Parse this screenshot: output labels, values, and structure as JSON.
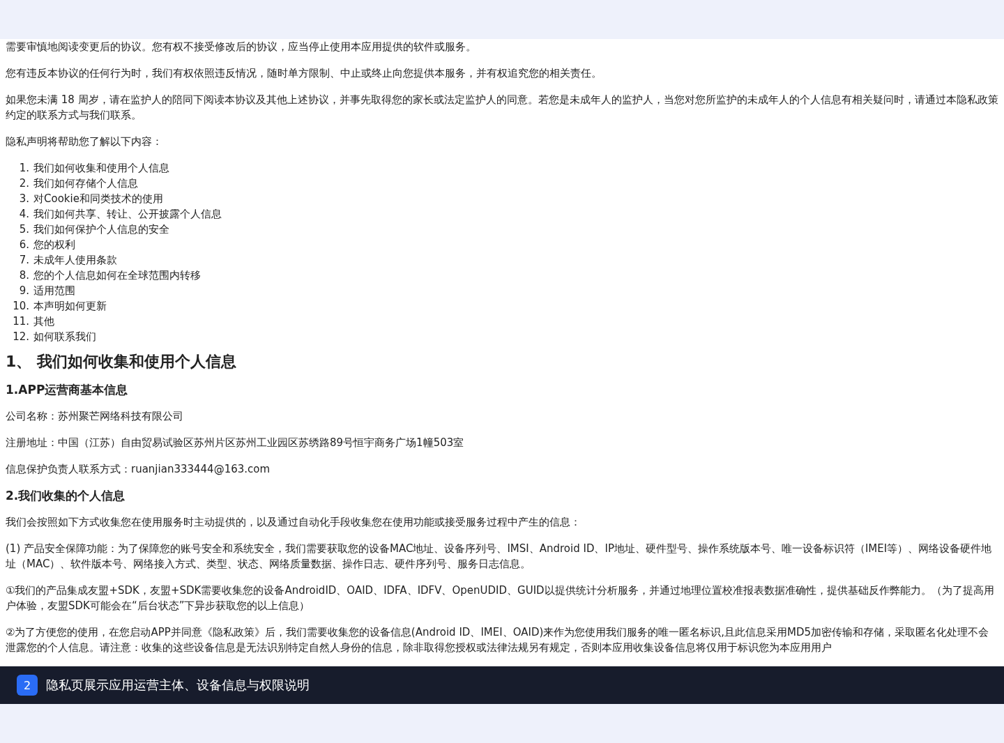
{
  "intro": [
    "需要审慎地阅读变更后的协议。您有权不接受修改后的协议，应当停止使用本应用提供的软件或服务。",
    "您有违反本协议的任何行为时，我们有权依照违反情况，随时单方限制、中止或终止向您提供本服务，并有权追究您的相关责任。",
    "如果您未满 18 周岁，请在监护人的陪同下阅读本协议及其他上述协议，并事先取得您的家长或法定监护人的同意。若您是未成年人的监护人，当您对您所监护的未成年人的个人信息有相关疑问时，请通过本隐私政策约定的联系方式与我们联系。",
    "隐私声明将帮助您了解以下内容："
  ],
  "toc": [
    {
      "number": "1.",
      "text": "我们如何收集和使用个人信息"
    },
    {
      "number": "2.",
      "text": "我们如何存储个人信息"
    },
    {
      "number": "3.",
      "text": "对Cookie和同类技术的使用"
    },
    {
      "number": "4.",
      "text": "我们如何共享、转让、公开披露个人信息"
    },
    {
      "number": "5.",
      "text": "我们如何保护个人信息的安全"
    },
    {
      "number": "6.",
      "text": "您的权利"
    },
    {
      "number": "7.",
      "text": "未成年人使用条款"
    },
    {
      "number": "8.",
      "text": "您的个人信息如何在全球范围内转移"
    },
    {
      "number": "9.",
      "text": "适用范围"
    },
    {
      "number": "10.",
      "text": "本声明如何更新"
    },
    {
      "number": "11.",
      "text": "其他"
    },
    {
      "number": "12.",
      "text": "如何联系我们"
    }
  ],
  "heading": "1、 我们如何收集和使用个人信息",
  "sections": [
    {
      "title": "1.APP运营商基本信息",
      "paragraphs": [
        "公司名称：苏州聚芒网络科技有限公司",
        "注册地址：中国（江苏）自由贸易试验区苏州片区苏州工业园区苏绣路89号恒宇商务广场1幢503室",
        "信息保护负责人联系方式：ruanjian333444@163.com"
      ]
    },
    {
      "title": "2.我们收集的个人信息",
      "paragraphs": [
        "我们会按照如下方式收集您在使用服务时主动提供的，以及通过自动化手段收集您在使用功能或接受服务过程中产生的信息：",
        "(1) 产品安全保障功能：为了保障您的账号安全和系统安全，我们需要获取您的设备MAC地址、设备序列号、IMSI、Android ID、IP地址、硬件型号、操作系统版本号、唯一设备标识符（IMEI等）、网络设备硬件地址（MAC）、软件版本号、网络接入方式、类型、状态、网络质量数据、操作日志、硬件序列号、服务日志信息。",
        "①我们的产品集成友盟+SDK，友盟+SDK需要收集您的设备AndroidID、OAID、IDFA、IDFV、OpenUDID、GUID以提供统计分析服务，并通过地理位置校准报表数据准确性，提供基础反作弊能力。（为了提高用户体验，友盟SDK可能会在“后台状态”下异步获取您的以上信息）",
        "②为了方便您的使用，在您启动APP并同意《隐私政策》后，我们需要收集您的设备信息(Android ID、IMEI、OAID)来作为您使用我们服务的唯一匿名标识,且此信息采用MD5加密传输和存储，采取匿名化处理不会泄露您的个人信息。请注意：收集的这些设备信息是无法识别特定自然人身份的信息，除非取得您授权或法律法规另有规定，否则本应用收集设备信息将仅用于标识您为本应用用户"
      ]
    }
  ],
  "caption": {
    "number": "2",
    "text": "隐私页展示应用运营主体、设备信息与权限说明"
  }
}
